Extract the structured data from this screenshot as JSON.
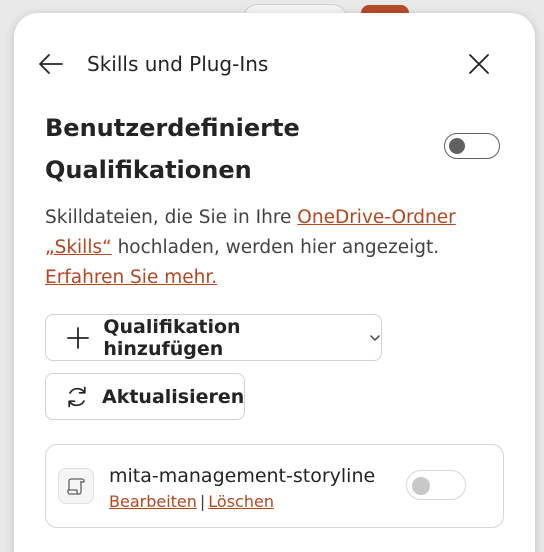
{
  "header": {
    "title": "Skills und Plug-Ins"
  },
  "section": {
    "title": "Benutzerdefinierte Qualifikationen",
    "toggle_on": false
  },
  "description": {
    "text_before": "Skilldateien, die Sie in Ihre ",
    "link_onedrive": "OneDrive-Ordner „Skills“",
    "text_middle": " hochladen, werden hier angezeigt. ",
    "link_learn_more": "Erfahren Sie mehr."
  },
  "buttons": {
    "add_label": "Qualifikation hinzufügen",
    "refresh_label": "Aktualisieren"
  },
  "skills": [
    {
      "name": "mita-management-storyline",
      "edit_label": "Bearbeiten",
      "separator": "|",
      "delete_label": "Löschen",
      "enabled": false
    }
  ],
  "colors": {
    "link": "#b5461f",
    "text": "#242424",
    "border": "#d1d1d1"
  }
}
